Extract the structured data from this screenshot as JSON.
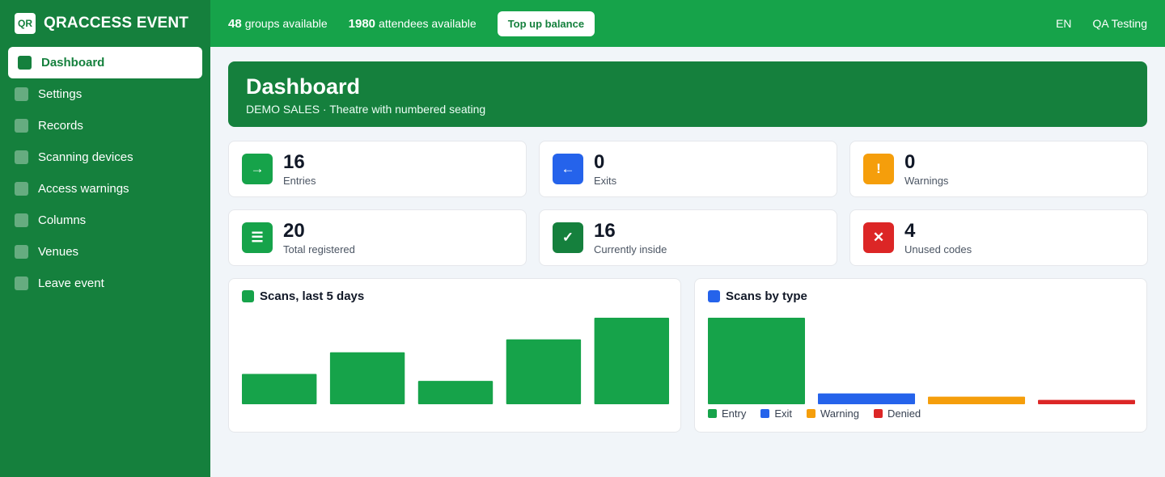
{
  "brand": {
    "logo_text": "QR",
    "name": "QRACCESS EVENT"
  },
  "sidebar": {
    "items": [
      {
        "label": "Dashboard",
        "active": true
      },
      {
        "label": "Settings"
      },
      {
        "label": "Records"
      },
      {
        "label": "Scanning devices"
      },
      {
        "label": "Access warnings"
      },
      {
        "label": "Columns"
      },
      {
        "label": "Venues"
      },
      {
        "label": "Leave event"
      }
    ]
  },
  "topbar": {
    "groups_count": "48",
    "groups_label": "groups available",
    "attendees_count": "1980",
    "attendees_label": "attendees available",
    "topup_label": "Top up balance",
    "language": "EN",
    "user": "QA Testing"
  },
  "hero": {
    "title": "Dashboard",
    "subtitle": "DEMO SALES · Theatre with numbered seating"
  },
  "stats": [
    {
      "value": "16",
      "label": "Entries",
      "icon": "arrow-right-icon",
      "glyph": "→",
      "color": "#16a34a"
    },
    {
      "value": "0",
      "label": "Exits",
      "icon": "arrow-left-icon",
      "glyph": "←",
      "color": "#2563eb"
    },
    {
      "value": "0",
      "label": "Warnings",
      "icon": "exclamation-icon",
      "glyph": "!",
      "color": "#f59e0b"
    },
    {
      "value": "20",
      "label": "Total registered",
      "icon": "list-icon",
      "glyph": "☰",
      "color": "#16a34a"
    },
    {
      "value": "16",
      "label": "Currently inside",
      "icon": "check-icon",
      "glyph": "✓",
      "color": "#15803d"
    },
    {
      "value": "4",
      "label": "Unused codes",
      "icon": "cross-icon",
      "glyph": "✕",
      "color": "#dc2626"
    }
  ],
  "charts": {
    "scans_title": "Scans, last 5 days",
    "scans_accent": "#16a34a",
    "types_title": "Scans by type",
    "types_accent": "#2563eb"
  },
  "chart_data": [
    {
      "type": "bar",
      "title": "Scans, last 5 days",
      "categories": [
        "",
        "",
        "",
        "",
        ""
      ],
      "values": [
        3.5,
        6,
        2.7,
        7.5,
        10
      ],
      "ylim": [
        0,
        10
      ],
      "color": "#16a34a",
      "grid": false
    },
    {
      "type": "bar",
      "title": "Scans by type",
      "categories": [
        "Entry",
        "Exit",
        "Warning",
        "Denied"
      ],
      "values": [
        16,
        2,
        1.4,
        0.8
      ],
      "ylim": [
        0,
        16
      ],
      "colors": [
        "#16a34a",
        "#2563eb",
        "#f59e0b",
        "#dc2626"
      ],
      "legend": "bottom",
      "grid": false
    }
  ]
}
